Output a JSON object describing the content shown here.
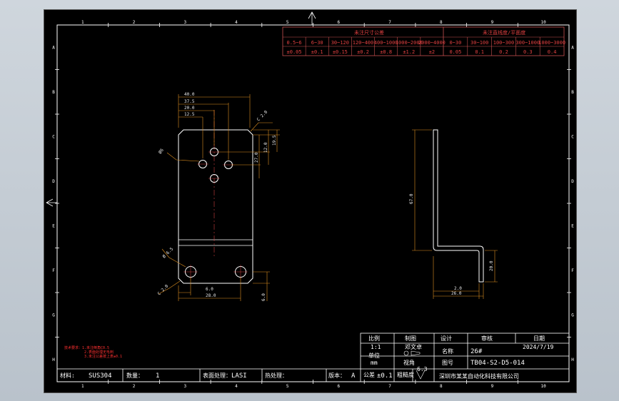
{
  "border_columns": [
    "1",
    "2",
    "3",
    "4",
    "5",
    "6",
    "7",
    "8",
    "9",
    "10"
  ],
  "border_rows": [
    "A",
    "B",
    "C",
    "D",
    "E",
    "F",
    "G",
    "H"
  ],
  "tolerance_table": {
    "left_title": "未注尺寸公差",
    "right_title": "未注直线度/平面度",
    "ranges_left": [
      "0.5~6",
      "6~30",
      "30~120",
      "120~400",
      "400~1000",
      "1000~2000",
      "2000~4000"
    ],
    "values_left": [
      "±0.05",
      "±0.1",
      "±0.15",
      "±0.2",
      "±0.8",
      "±1.2",
      "±2"
    ],
    "ranges_right": [
      "0~30",
      "30~100",
      "100~300",
      "300~1000",
      "1000~3000"
    ],
    "values_right": [
      "0.05",
      "0.1",
      "0.2",
      "0.3",
      "0.4"
    ]
  },
  "front_view": {
    "dims_top": [
      "40.0",
      "37.5",
      "20.0",
      "12.5"
    ],
    "dim_chamfer_top": "C 2.0",
    "dims_right": [
      "19.5",
      "12.0",
      "27.0"
    ],
    "label_hole": "Ø6",
    "label_hole_bottom": "Ø 6.5",
    "label_chamfer_bottom": "C 2.0",
    "dims_bottom": [
      "6.0",
      "28.0"
    ],
    "dim_bottom_right": "6.0"
  },
  "side_view": {
    "dim_height": "67.0",
    "dim_flange_height": "20.0",
    "dim_inner": "2.0",
    "dim_width": "26.0"
  },
  "notes": [
    "技术要求：1.未注倒角C0.5",
    "2.表面处理无毛刺",
    "3.未注公差按上表±0.1"
  ],
  "title_block": {
    "scale_label": "比例",
    "scale_value": "1:1",
    "draw_label": "制图",
    "draw_value": "邓文卓",
    "design_label": "设计",
    "check_label": "审核",
    "date_label": "日期",
    "date_value": "2024/7/19",
    "unit_label": "单位",
    "unit_value": "mm",
    "name_label": "名称",
    "name_value": "26#",
    "drawing_no_label": "图号",
    "drawing_no_value": "TB04-S2-D5-014",
    "view_label": "视角",
    "tol_label": "公差",
    "tol_value": "±0.1",
    "roughness_label": "粗糙度",
    "roughness_value": "6.3",
    "material_label": "材料:",
    "material_value": "SUS304",
    "qty_label": "数量：",
    "qty_value": "1",
    "surface_label": "表面处理：",
    "surface_value": "LASI",
    "heat_label": "热处理：",
    "version_label": "版本：",
    "version_value": "A",
    "company": "深圳市某某自动化科技有限公司"
  },
  "colors": {
    "background": "#000000",
    "part_outline": "#ffffff",
    "dimension": "#e09020",
    "table_line": "#c85050",
    "table_text": "#e04040",
    "centerline": "#d04040"
  }
}
